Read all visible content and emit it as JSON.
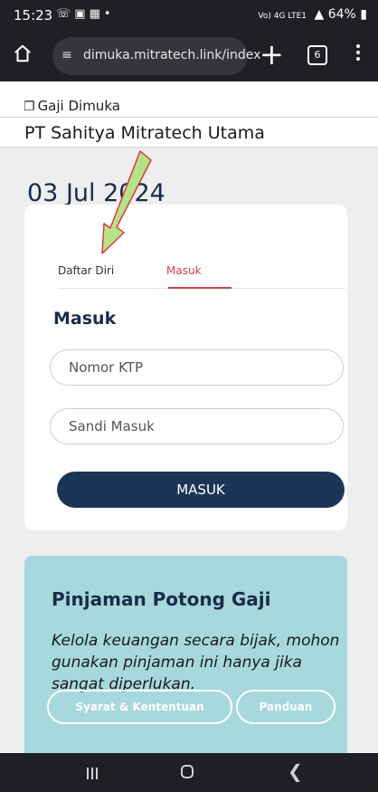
{
  "status_bar": {
    "time": "15:23",
    "icons": [
      "whatsapp-icon",
      "notification-icon",
      "gallery-icon",
      "dot-icon"
    ],
    "network": "Vo) 4G LTE1",
    "signal": "signal-icon",
    "battery": "64%"
  },
  "browser": {
    "url": "dimuka.mitratech.link/index",
    "tab_count": "6"
  },
  "page": {
    "app_name": "Gaji Dimuka",
    "company": "PT Sahitya Mitratech Utama",
    "date": "03 Jul 2024"
  },
  "login": {
    "tabs": [
      "Daftar Diri",
      "Masuk"
    ],
    "active_tab": "Masuk",
    "title": "Masuk",
    "ktp_placeholder": "Nomor KTP",
    "password_placeholder": "Sandi Masuk",
    "submit_label": "MASUK"
  },
  "info": {
    "title": "Pinjaman Potong Gaji",
    "text": "Kelola keuangan secara bijak, mohon gunakan pinjaman ini hanya jika sangat diperlukan.",
    "terms_label": "Syarat & Kententuan",
    "guide_label": "Panduan"
  },
  "colors": {
    "primary": "#1b3556",
    "accent": "#c9414a",
    "info_bg": "#a7d8dc",
    "arrow_fill": "#b5e38a",
    "arrow_stroke": "#e03030"
  }
}
